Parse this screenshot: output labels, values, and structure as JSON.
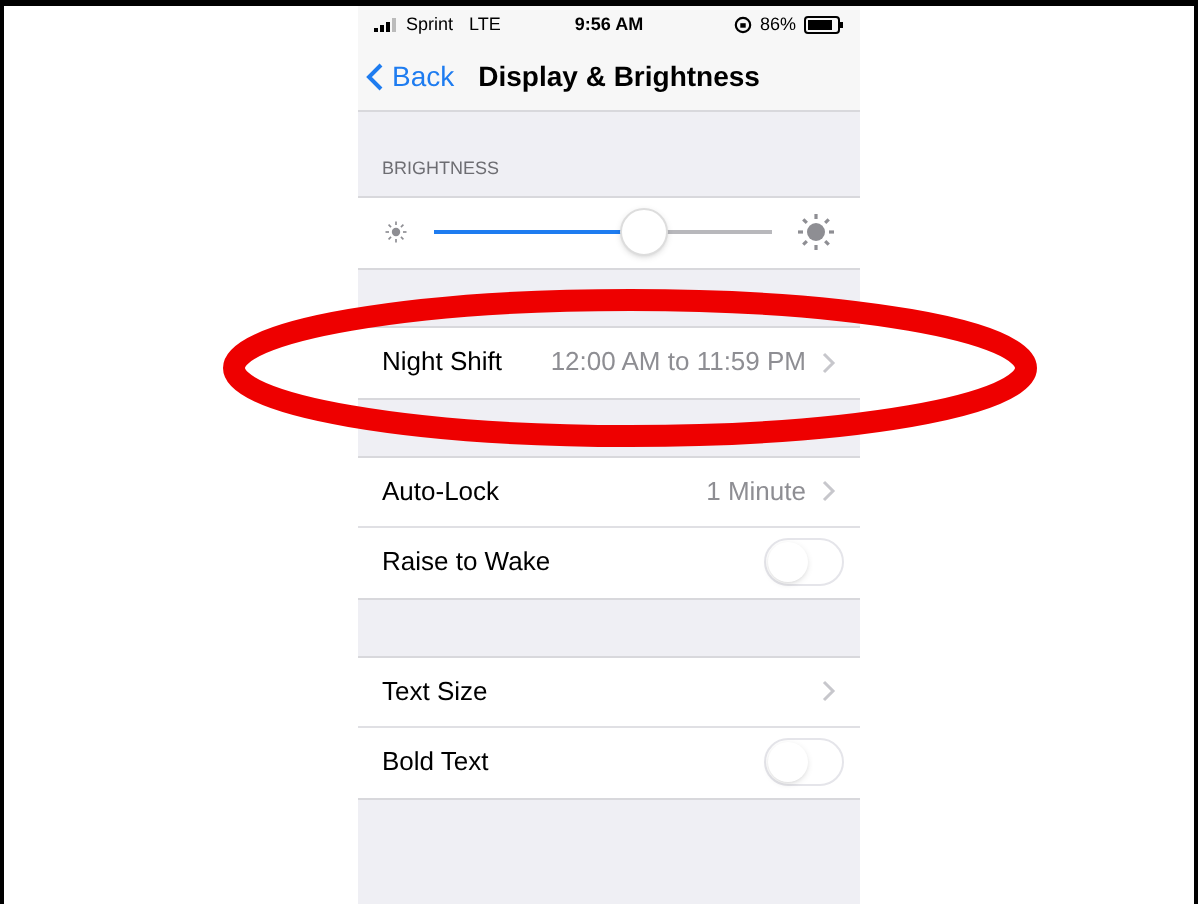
{
  "status_bar": {
    "carrier": "Sprint",
    "network": "LTE",
    "time": "9:56 AM",
    "battery": "86%"
  },
  "nav": {
    "back": "Back",
    "title": "Display & Brightness"
  },
  "sections": [
    {
      "header": "BRIGHTNESS",
      "rows": [
        {
          "kind": "slider",
          "level": 0.62
        }
      ]
    },
    {
      "rows": [
        {
          "kind": "link",
          "label": "Night Shift",
          "value": "12:00 AM to 11:59 PM"
        }
      ]
    },
    {
      "rows": [
        {
          "kind": "link",
          "label": "Auto-Lock",
          "value": "1 Minute"
        },
        {
          "kind": "toggle",
          "label": "Raise to Wake",
          "on": false
        }
      ]
    },
    {
      "rows": [
        {
          "kind": "link",
          "label": "Text Size"
        },
        {
          "kind": "toggle",
          "label": "Bold Text",
          "on": false
        }
      ]
    }
  ],
  "annotation": {
    "kind": "ellipse"
  }
}
